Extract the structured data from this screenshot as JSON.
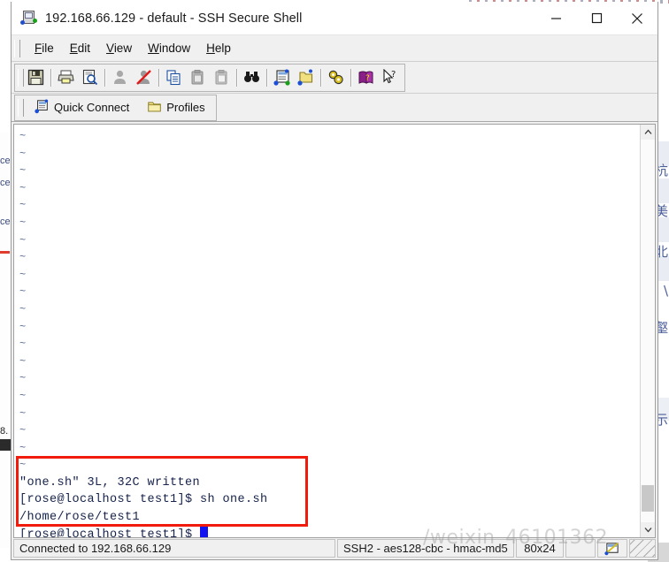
{
  "window": {
    "title": "192.168.66.129 - default - SSH Secure Shell",
    "icon": "ssh-terminal-icon",
    "minimize_label": "Minimize",
    "maximize_label": "Maximize",
    "close_label": "Close"
  },
  "menubar": {
    "items": [
      {
        "label": "File",
        "mnemonic": "F",
        "rest": "ile"
      },
      {
        "label": "Edit",
        "mnemonic": "E",
        "rest": "dit"
      },
      {
        "label": "View",
        "mnemonic": "V",
        "rest": "iew"
      },
      {
        "label": "Window",
        "mnemonic": "W",
        "rest": "indow"
      },
      {
        "label": "Help",
        "mnemonic": "H",
        "rest": "elp"
      }
    ]
  },
  "toolbar": {
    "buttons": [
      {
        "name": "save-icon",
        "label": "Save"
      },
      {
        "name": "print-icon",
        "label": "Print"
      },
      {
        "name": "print-preview-icon",
        "label": "Print Preview"
      },
      {
        "name": "connect-icon",
        "label": "Connect"
      },
      {
        "name": "disconnect-icon",
        "label": "Disconnect"
      },
      {
        "name": "copy-icon",
        "label": "Copy"
      },
      {
        "name": "paste-icon",
        "label": "Paste"
      },
      {
        "name": "paste-alt-icon",
        "label": "Paste Selection"
      },
      {
        "name": "find-icon",
        "label": "Find"
      },
      {
        "name": "new-terminal-icon",
        "label": "New Terminal Window"
      },
      {
        "name": "new-file-transfer-icon",
        "label": "New File Transfer Window"
      },
      {
        "name": "settings-icon",
        "label": "Settings"
      },
      {
        "name": "help-book-icon",
        "label": "Help"
      },
      {
        "name": "context-help-icon",
        "label": "Context Help"
      }
    ]
  },
  "quickbar": {
    "quick_connect": "Quick Connect",
    "profiles": "Profiles"
  },
  "terminal": {
    "tilde_glyph": "~",
    "tilde_rows": 20,
    "lines": [
      "\"one.sh\" 3L, 32C written",
      "[rose@localhost test1]$ sh one.sh",
      "/home/rose/test1"
    ],
    "prompt": "[rose@localhost test1]$ ",
    "cursor_color": "#1414f0",
    "highlight_color": "#f01b0c"
  },
  "scrollbar": {
    "up_arrow": "scroll-up-icon",
    "down_arrow": "scroll-down-icon"
  },
  "statusbar": {
    "connection": "Connected to 192.168.66.129",
    "cipher": "SSH2 - aes128-cbc - hmac-md5",
    "size": "80x24",
    "indicator_icon": "encryption-icon"
  },
  "watermark": {
    "text": "/weixin_46101362"
  },
  "backdrop": {
    "left_fragments": [
      "ce",
      "ce",
      "ce",
      "8."
    ],
    "right_cjk": [
      "杭",
      "美",
      "e北",
      "\\",
      "壑",
      "示"
    ]
  }
}
